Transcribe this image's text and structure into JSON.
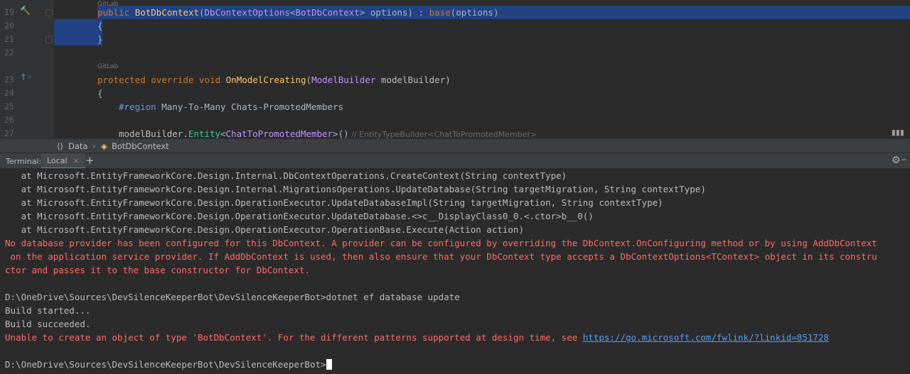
{
  "editor": {
    "line_numbers": [
      "19",
      "20",
      "21",
      "22",
      "23",
      "24",
      "25",
      "26",
      "27"
    ],
    "codelens_author": "GitLab",
    "code": {
      "l19": {
        "kw": "public",
        "name": "BotDbContext",
        "paren_open": "(",
        "param_type": "DbContextOptions",
        "lt": "<",
        "generic": "BotDbContext",
        "rest": "> options) : ",
        "base": "base",
        "tail": "(options)"
      },
      "l20": "{",
      "l21": "}",
      "l23": {
        "kw1": "protected",
        "kw2": "override",
        "kw3": "void",
        "method": "OnModelCreating",
        "p_open": "(",
        "param_type": "ModelBuilder",
        "param": " modelBuilder)"
      },
      "l24": "{",
      "l25": {
        "directive": "#region",
        "text": " Many-To-Many Chats-PromotedMembers"
      },
      "l27": {
        "obj": "modelBuilder",
        "dot": ".",
        "method": "Entity",
        "lt": "<",
        "generic": "ChatToPromotedMember",
        "tail": ">()",
        "hint": " // EntityTypeBuilder<ChatToPromotedMember>"
      }
    }
  },
  "breadcrumb": {
    "ns": "Data",
    "cls": "BotDbContext"
  },
  "terminal": {
    "label": "Terminal:",
    "tab": "Local",
    "tab_close": "×",
    "add": "+",
    "lines": [
      {
        "t": "   at Microsoft.EntityFrameworkCore.Design.Internal.DbContextOperations.CreateContext(String contextType)"
      },
      {
        "t": "   at Microsoft.EntityFrameworkCore.Design.Internal.MigrationsOperations.UpdateDatabase(String targetMigration, String contextType)"
      },
      {
        "t": "   at Microsoft.EntityFrameworkCore.Design.OperationExecutor.UpdateDatabaseImpl(String targetMigration, String contextType)"
      },
      {
        "t": "   at Microsoft.EntityFrameworkCore.Design.OperationExecutor.UpdateDatabase.<>c__DisplayClass0_0.<.ctor>b__0()"
      },
      {
        "t": "   at Microsoft.EntityFrameworkCore.Design.OperationExecutor.OperationBase.Execute(Action action)"
      },
      {
        "t": "No database provider has been configured for this DbContext. A provider can be configured by overriding the DbContext.OnConfiguring method or by using AddDbContext"
      },
      {
        "t": " on the application service provider. If AddDbContext is used, then also ensure that your DbContext type accepts a DbContextOptions<TContext> object in its constru"
      },
      {
        "t": "ctor and passes it to the base constructor for DbContext."
      },
      {
        "t": ""
      },
      {
        "t": "D:\\OneDrive\\Sources\\DevSilenceKeeperBot\\DevSilenceKeeperBot>dotnet ef database update"
      },
      {
        "t": "Build started..."
      },
      {
        "t": "Build succeeded."
      },
      {
        "t": "Unable to create an object of type 'BotDbContext'. For the different patterns supported at design time, see ",
        "link": "https://go.microsoft.com/fwlink/?linkid=851728"
      },
      {
        "t": ""
      },
      {
        "t": "D:\\OneDrive\\Sources\\DevSilenceKeeperBot\\DevSilenceKeeperBot>"
      }
    ]
  },
  "colors": {
    "error": "#ff6b68",
    "link": "#5c9cf5",
    "selection": "#214283"
  }
}
